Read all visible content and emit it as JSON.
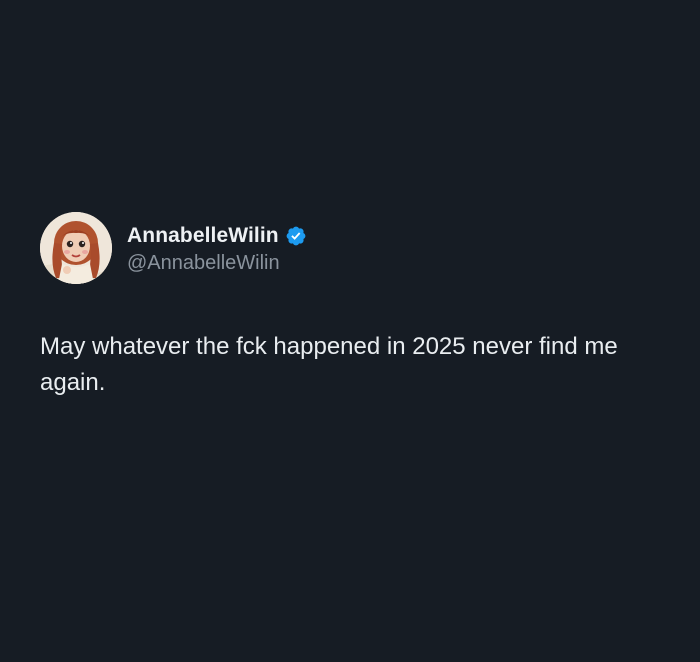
{
  "tweet": {
    "author": {
      "display_name": "AnnabelleWilin",
      "handle": "@AnnabelleWilin",
      "verified": true,
      "avatar_icon": "doll-avatar",
      "verified_icon": "verified-badge-icon"
    },
    "text": "May whatever the fck happened in 2025 never find me again."
  },
  "colors": {
    "background": "#161c24",
    "primary_text": "#e9edf0",
    "secondary_text": "#8a939d",
    "verified_blue": "#1d9bf0"
  }
}
